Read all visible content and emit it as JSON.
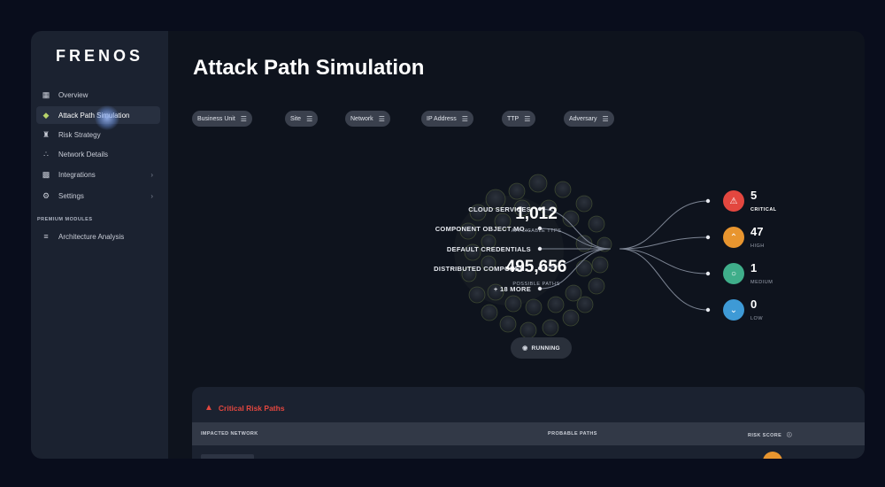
{
  "brand": {
    "logo_text": "FRENOS"
  },
  "sidebar": {
    "items": [
      {
        "label": "Overview",
        "icon": "grid-icon",
        "active": false,
        "has_chevron": false
      },
      {
        "label": "Attack Path Simulation",
        "icon": "target-icon",
        "active": true,
        "has_chevron": false
      },
      {
        "label": "Risk Strategy",
        "icon": "chess-icon",
        "active": false,
        "has_chevron": false
      },
      {
        "label": "Network Details",
        "icon": "network-icon",
        "active": false,
        "has_chevron": false
      },
      {
        "label": "Integrations",
        "icon": "puzzle-icon",
        "active": false,
        "has_chevron": true
      },
      {
        "label": "Settings",
        "icon": "gear-icon",
        "active": false,
        "has_chevron": true
      }
    ],
    "premium_label": "PREMIUM MODULES",
    "premium_items": [
      {
        "label": "Architecture Analysis",
        "icon": "architecture-icon"
      }
    ]
  },
  "page": {
    "title": "Attack Path Simulation"
  },
  "filters": [
    "Business Unit",
    "Site",
    "Network",
    "IP Address",
    "TTP",
    "Adversary"
  ],
  "graph": {
    "sources": [
      "CLOUD SERVICES",
      "COMPONENT OBJECT MO...",
      "DEFAULT CREDENTIALS",
      "DISTRIBUTED COMPONEN...",
      "+ 18 MORE"
    ],
    "applicable_ttps_value": "1,012",
    "applicable_ttps_label": "APPLICABLE TTPS",
    "possible_paths_value": "495,656",
    "possible_paths_label": "POSSIBLE PATHS",
    "risks": [
      {
        "count": "5",
        "label": "CRITICAL",
        "color": "#e3473f",
        "icon": "warning-icon"
      },
      {
        "count": "47",
        "label": "HIGH",
        "color": "#e8952f",
        "icon": "chevron-up-icon"
      },
      {
        "count": "1",
        "label": "MEDIUM",
        "color": "#3fae8a",
        "icon": "circle-icon"
      },
      {
        "count": "0",
        "label": "LOW",
        "color": "#3e9ad6",
        "icon": "chevron-down-icon"
      }
    ],
    "status_label": "RUNNING"
  },
  "critical_panel": {
    "title": "Critical Risk Paths",
    "columns": [
      "IMPACTED NETWORK",
      "PROBABLE PATHS",
      "RISK SCORE"
    ]
  }
}
